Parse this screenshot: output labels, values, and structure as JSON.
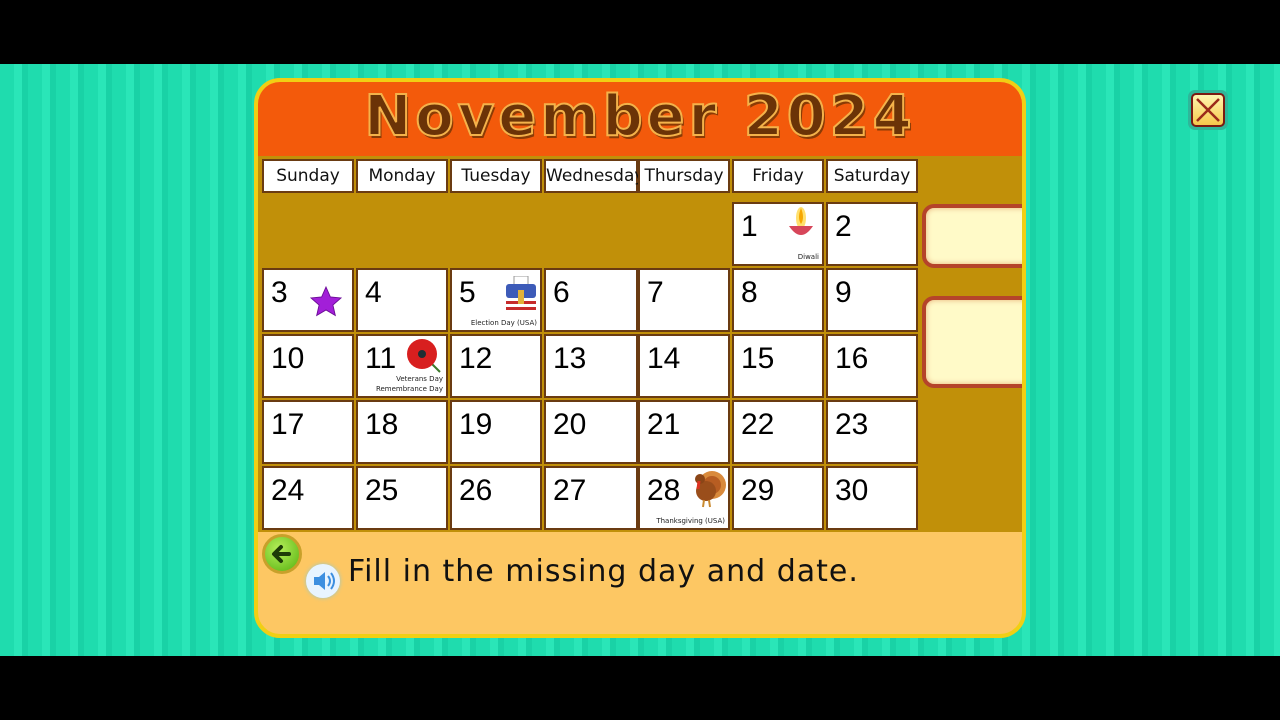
{
  "calendar": {
    "title": "November 2024",
    "weekdays": [
      "Sunday",
      "Monday",
      "Tuesday",
      "Wednesday",
      "Thursday",
      "Friday",
      "Saturday"
    ],
    "first_weekday_index": 5,
    "days": [
      {
        "date": "1",
        "note": "Diwali",
        "icon": "diya-lamp-icon"
      },
      {
        "date": "2"
      },
      {
        "date": "3",
        "icon": "star-icon"
      },
      {
        "date": "4"
      },
      {
        "date": "5",
        "note": "Election Day (USA)",
        "icon": "ballot-box-icon"
      },
      {
        "date": "6"
      },
      {
        "date": "7"
      },
      {
        "date": "8"
      },
      {
        "date": "9"
      },
      {
        "date": "10"
      },
      {
        "date": "11",
        "note": "Veterans Day\nRemembrance Day",
        "icon": "poppy-icon"
      },
      {
        "date": "12"
      },
      {
        "date": "13"
      },
      {
        "date": "14"
      },
      {
        "date": "15"
      },
      {
        "date": "16"
      },
      {
        "date": "17"
      },
      {
        "date": "18"
      },
      {
        "date": "19"
      },
      {
        "date": "20"
      },
      {
        "date": "21"
      },
      {
        "date": "22"
      },
      {
        "date": "23"
      },
      {
        "date": "24"
      },
      {
        "date": "25"
      },
      {
        "date": "26"
      },
      {
        "date": "27"
      },
      {
        "date": "28",
        "note": "Thanksgiving (USA)",
        "icon": "turkey-icon"
      },
      {
        "date": "29"
      },
      {
        "date": "30"
      }
    ]
  },
  "answer_slots": [
    {
      "value": ""
    },
    {
      "value": ""
    }
  ],
  "instruction": "Fill in the missing day and date.",
  "colors": {
    "background": "#1fdcae",
    "header": "#f35a0b",
    "grid": "#c19009",
    "panel": "#fdc763",
    "panel_border": "#f1cf14"
  }
}
